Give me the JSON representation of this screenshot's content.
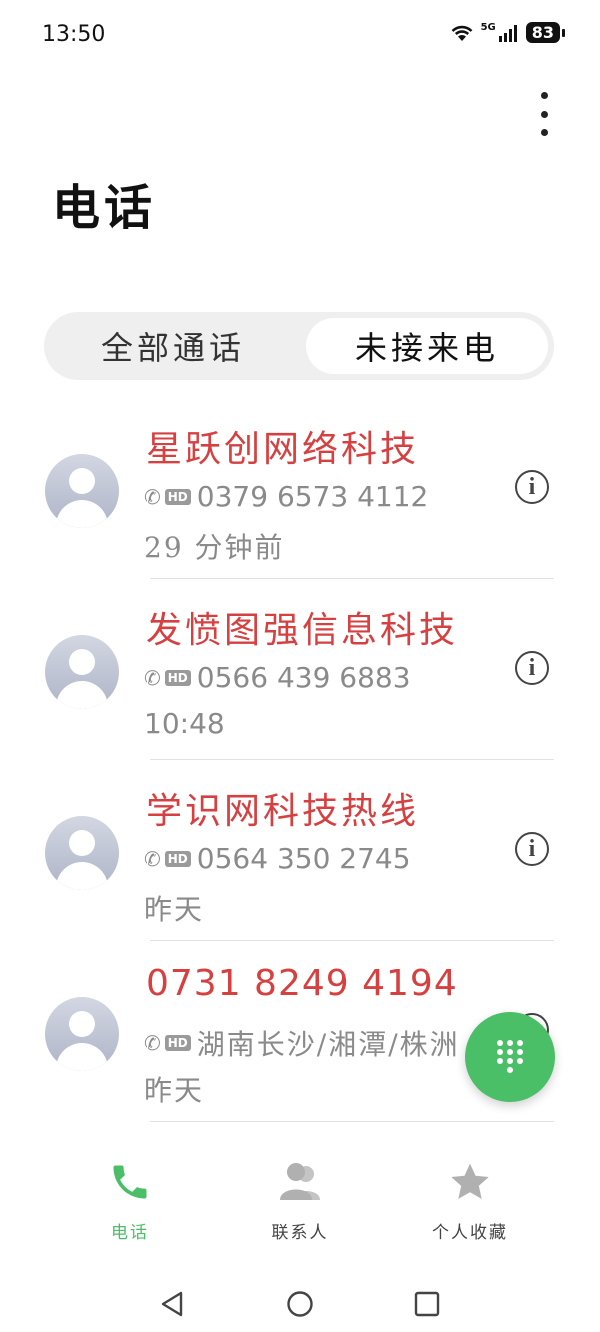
{
  "status_bar": {
    "time": "13:50",
    "network": "5G",
    "battery": "83"
  },
  "header": {
    "title": "电话"
  },
  "tabs": {
    "all_calls": "全部通话",
    "missed_calls": "未接来电",
    "selected": "未接来电"
  },
  "calls": [
    {
      "name": "星跃创网络科技",
      "detail": "0379 6573 4112",
      "time": "29 分钟前",
      "is_number": false
    },
    {
      "name": "发愤图强信息科技",
      "detail": "0566 439 6883",
      "time": "10:48",
      "is_number": false
    },
    {
      "name": "学识网科技热线",
      "detail": "0564 350 2745",
      "time": "昨天",
      "is_number": false
    },
    {
      "name": "0731 8249 4194",
      "detail": "湖南长沙/湘潭/株洲",
      "time": "昨天",
      "is_number": true
    }
  ],
  "bottom_nav": {
    "phone": "电话",
    "contacts": "联系人",
    "favorites": "个人收藏",
    "active": "phone"
  },
  "colors": {
    "accent_green": "#4bbf68",
    "missed_red": "#d64040"
  },
  "icons": [
    "wifi-icon",
    "signal-icon",
    "more-vert-icon",
    "missed-call-icon",
    "hd-badge",
    "info-icon",
    "dialpad-icon",
    "phone-icon",
    "contacts-icon",
    "star-icon",
    "back-icon",
    "home-icon",
    "recents-icon"
  ]
}
